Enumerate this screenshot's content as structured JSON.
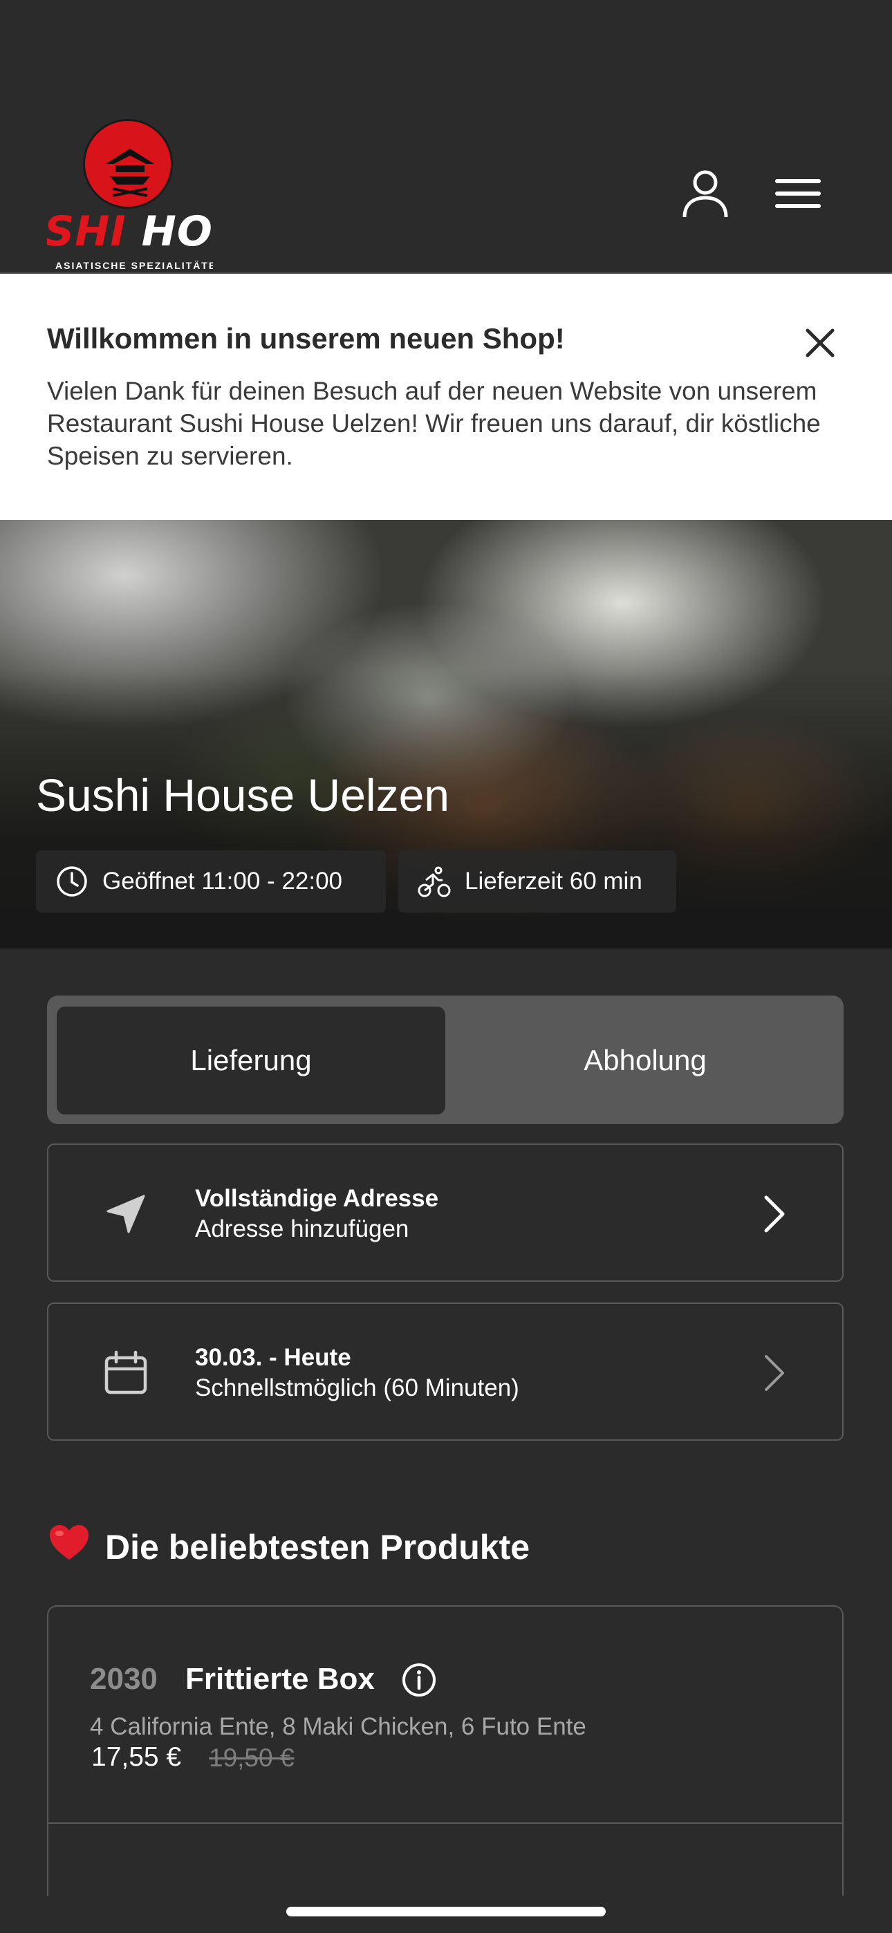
{
  "header": {
    "logo_text_red": "SHI",
    "logo_text_white": "HOU",
    "logo_subtitle": "ASIATISCHE SPEZIALITÄTEN",
    "user_icon": "user-icon",
    "menu_icon": "hamburger-menu-icon"
  },
  "banner": {
    "title": "Willkommen in unserem neuen Shop!",
    "text": "Vielen Dank für deinen Besuch auf der neuen Website von unserem Restaurant Sushi House Uelzen! Wir freuen uns darauf, dir köstliche Speisen zu servieren.",
    "close_icon": "close-icon"
  },
  "hero": {
    "title": "Sushi House Uelzen",
    "opening": "Geöffnet 11:00 - 22:00",
    "delivery_time": "Lieferzeit 60 min",
    "clock_icon": "clock-icon",
    "bike_icon": "bike-courier-icon"
  },
  "order_mode": {
    "delivery": "Lieferung",
    "pickup": "Abholung",
    "selected": "Lieferung"
  },
  "address_card": {
    "title": "Vollständige Adresse",
    "subtitle": "Adresse hinzufügen",
    "icon": "location-arrow-icon"
  },
  "time_card": {
    "title": "30.03. - Heute",
    "subtitle": "Schnellstmöglich (60 Minuten)",
    "icon": "calendar-icon"
  },
  "popular": {
    "emoji": "❤️",
    "title": "Die beliebtesten Produkte",
    "products": [
      {
        "number": "2030",
        "name": "Frittierte Box",
        "description": "4 California Ente, 8 Maki Chicken, 6 Futo Ente",
        "price": "17,55 €",
        "old_price": "19,50 €"
      }
    ]
  },
  "colors": {
    "background": "#2b2b2c",
    "toggle_bg": "#59595a",
    "brand_red": "#d8141a",
    "banner_bg": "#ffffff"
  }
}
